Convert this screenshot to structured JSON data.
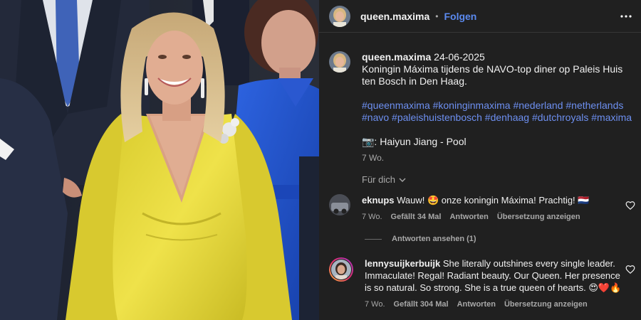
{
  "post": {
    "username": "queen.maxima",
    "separator": "•",
    "follow_label": "Folgen",
    "more_icon": "more-horizontal-icon"
  },
  "caption": {
    "username": "queen.maxima",
    "date": "24-06-2025",
    "text": "Koningin Máxima tijdens de NAVO-top diner op Paleis Huis ten Bosch in Den Haag.",
    "hashtags": "#queenmaxima #koninginmaxima #nederland #netherlands #navo #paleishuistenbosch #denhaag #dutchroyals #maxima",
    "credit": "📷: Haiyun Jiang - Pool",
    "time": "7 Wo."
  },
  "for_you": {
    "label": "Für dich",
    "icon": "chevron-down-icon"
  },
  "comments": [
    {
      "username": "eknups",
      "text": "Wauw! 🤩 onze koningin Máxima! Prachtig! 🇳🇱",
      "time": "7 Wo.",
      "likes": "Gefällt 34 Mal",
      "reply_label": "Antworten",
      "translate_label": "Übersetzung anzeigen",
      "view_replies": "Antworten ansehen (1)"
    },
    {
      "username": "lennysuijkerbuijk",
      "text": "She literally outshines every single leader. Immaculate! Regal! Radiant beauty. Our Queen. Her presence is so natural. So strong. She is a true queen of hearts. 😍❤️🔥",
      "time": "7 Wo.",
      "likes": "Gefällt 304 Mal",
      "reply_label": "Antworten",
      "translate_label": "Übersetzung anzeigen"
    }
  ],
  "colors": {
    "background": "#202020",
    "link": "#5b8af0",
    "hashtag": "#6d8ff0",
    "muted": "#a8a8a8",
    "dress": "#e6d93c",
    "blue_dress": "#1f4fc9"
  }
}
